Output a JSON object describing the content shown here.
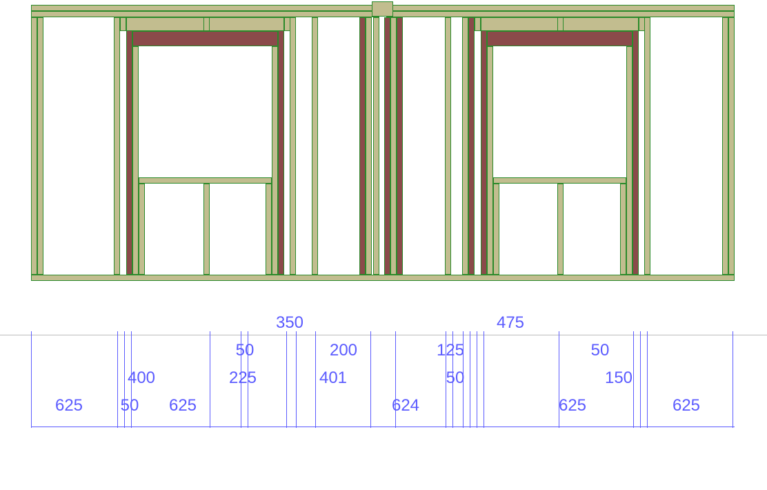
{
  "diagram": {
    "type": "wall-framing-elevation",
    "total_width_mm": 5100,
    "units": "mm"
  },
  "dims": {
    "r4": {
      "d350": "350",
      "d475": "475"
    },
    "r3": {
      "d50a": "50",
      "d200": "200",
      "d125": "125",
      "d50b": "50"
    },
    "r2": {
      "d400": "400",
      "d225": "225",
      "d401": "401",
      "d50": "50",
      "d150": "150"
    },
    "r1": {
      "d625a": "625",
      "d50": "50",
      "d625b": "625",
      "d624": "624",
      "d625c": "625",
      "d625d": "625"
    }
  }
}
